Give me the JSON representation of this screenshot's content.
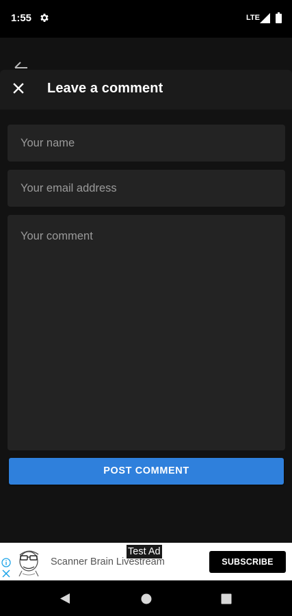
{
  "status_bar": {
    "time": "1:55",
    "network": "LTE",
    "icons": [
      "gear-icon",
      "signal-icon",
      "battery-icon"
    ]
  },
  "header": {
    "title": "Leave a comment",
    "close_icon": "close-icon"
  },
  "form": {
    "name_placeholder": "Your name",
    "email_placeholder": "Your email address",
    "comment_placeholder": "Your comment",
    "submit_label": "POST COMMENT"
  },
  "ad": {
    "badge": "Test Ad",
    "title": "Scanner Brain Livestream",
    "cta": "SUBSCRIBE"
  },
  "nav_bar": {
    "icons": [
      "back-triangle-icon",
      "home-circle-icon",
      "recents-square-icon"
    ]
  },
  "colors": {
    "background": "#121212",
    "surface": "#232323",
    "accent": "#2f80dc",
    "placeholder": "#9a9a9a"
  }
}
